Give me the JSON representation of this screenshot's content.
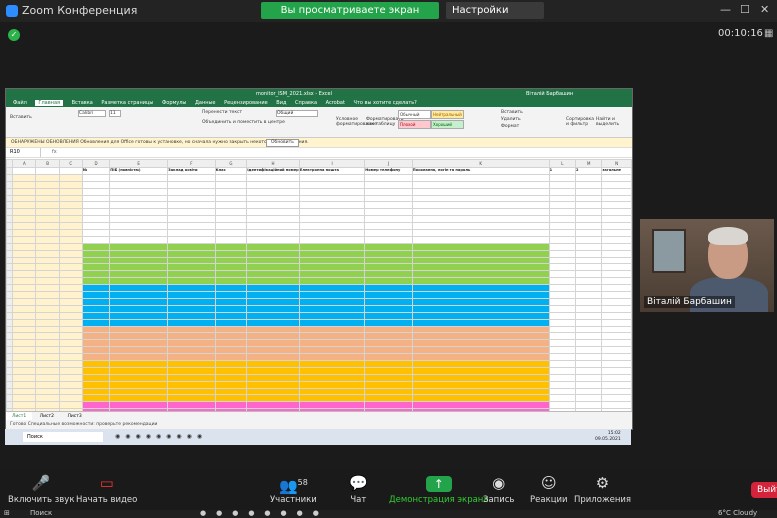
{
  "window": {
    "title": "Zoom Конференция",
    "timer": "00:10:16"
  },
  "banner": {
    "sharing_text": "Вы просматриваете экран Віталій Барбашин",
    "view_options": "Настройки просмотра ⌄"
  },
  "excel": {
    "title": "monitor_ISM_2021.xlsx - Excel",
    "user": "Віталій Барбашин",
    "tabs": [
      "Файл",
      "Главная",
      "Вставка",
      "Разметка страницы",
      "Формулы",
      "Данные",
      "Рецензирование",
      "Вид",
      "Справка",
      "Acrobat",
      "Что вы хотите сделать?"
    ],
    "ribbon": {
      "paste": "Вставить",
      "font": "Calibri",
      "size": "11",
      "wrap": "Перенести текст",
      "merge": "Объединить и поместить в центре",
      "number_format": "Общий",
      "cond_format": "Условное форматирование",
      "format_table": "Форматировать как таблицу",
      "style_normal": "Обычный",
      "style_neutral": "Нейтральный",
      "style_bad": "Плохой",
      "style_good": "Хороший",
      "insert": "Вставить",
      "delete": "Удалить",
      "format": "Формат",
      "sort": "Сортировка и фильтр",
      "find": "Найти и выделить"
    },
    "message_bar": "ОБНАРУЖЕНЫ ОБНОВЛЕНИЯ  Обновления для Office готовы к установке, но сначала нужно закрыть некоторые приложения.",
    "message_button": "Обновить",
    "cell_ref": "R10",
    "fx": "fx",
    "headers": [
      "",
      "A",
      "B",
      "C",
      "D",
      "E",
      "F",
      "G",
      "H",
      "I",
      "J",
      "K",
      "L",
      "M",
      "N"
    ],
    "header_labels": [
      "",
      "",
      "",
      "",
      "№",
      "ПІБ (повністю)",
      "Заклад освіти",
      "Клас",
      "Ідентифікаційний номер",
      "Електронна пошта",
      "Номер телефону",
      "Посилання, логін та пароль",
      "1",
      "2",
      "загальне"
    ],
    "sheet_tabs": [
      "Лист1",
      "Лист2",
      "Лист3"
    ],
    "status": "Готово   Специальные возможности: проверьте рекомендации",
    "taskbar_search": "Поиск",
    "clock_time": "15:02",
    "clock_date": "09.05.2021"
  },
  "participant": {
    "name": "Віталій Барбашин"
  },
  "toolbar": {
    "mute": "Включить звук",
    "video": "Начать видео",
    "participants": "Участники",
    "participants_count": "58",
    "chat": "Чат",
    "share": "Демонстрация экрана",
    "record": "Запись",
    "reactions": "Реакции",
    "apps": "Приложения",
    "leave": "Выйти"
  },
  "win_taskbar": {
    "search": "Поиск",
    "weather": "6°C Cloudy"
  },
  "colors": {
    "excel_green": "#217346",
    "zoom_green": "#23a34a",
    "leave_red": "#d4233a"
  }
}
